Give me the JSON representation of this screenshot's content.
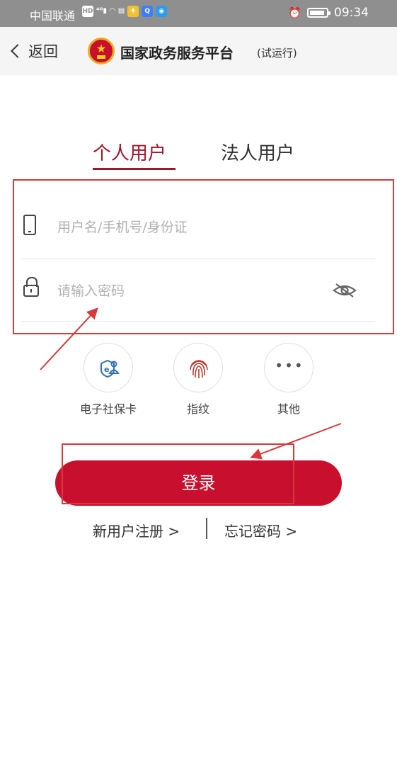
{
  "status_bar": {
    "carrier": "中国联通",
    "icons": [
      "hd-icon",
      "4g-signal-icon",
      "wifi-icon",
      "sim-icon",
      "app-icon",
      "search-app-icon",
      "bulb-app-icon"
    ],
    "time": "09:34"
  },
  "header": {
    "back_label": "返回",
    "title": "国家政务服务平台",
    "subtitle": "(试运行)"
  },
  "tabs": [
    {
      "label": "个人用户",
      "active": true
    },
    {
      "label": "法人用户",
      "active": false
    }
  ],
  "form": {
    "username_placeholder": "用户名/手机号/身份证",
    "password_placeholder": "请输入密码"
  },
  "alt_login": [
    {
      "label": "电子社保卡",
      "icon": "social-security-card-icon"
    },
    {
      "label": "指纹",
      "icon": "fingerprint-icon"
    },
    {
      "label": "其他",
      "icon": "more-icon"
    }
  ],
  "login_button": "登录",
  "links": {
    "register": "新用户注册 >",
    "forgot": "忘记密码 >"
  },
  "colors": {
    "brand": "#c8102e",
    "active_tab": "#a0162a",
    "annotation": "#d63a3a"
  }
}
